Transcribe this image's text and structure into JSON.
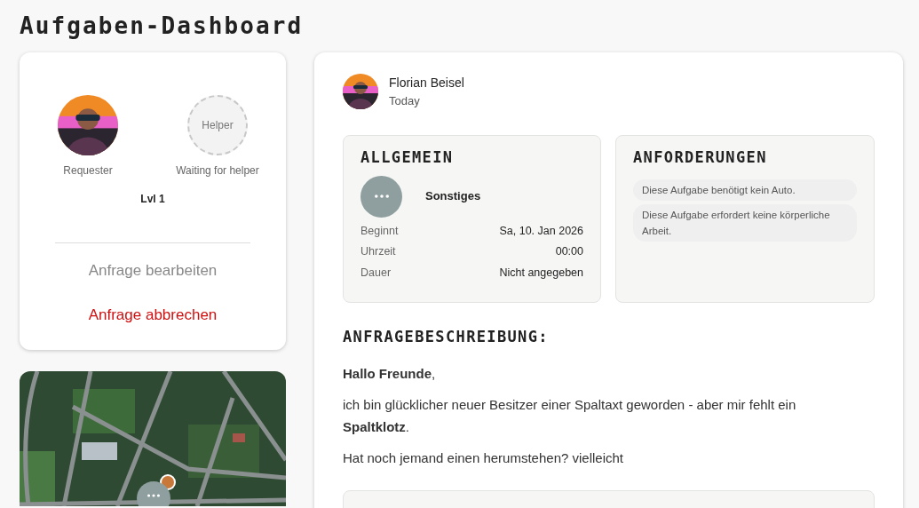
{
  "title": "Aufgaben-Dashboard",
  "participants": [
    {
      "kind": "avatar",
      "role": "Requester"
    },
    {
      "kind": "placeholder",
      "circle_label": "Helper",
      "role": "Waiting for helper"
    }
  ],
  "level": "Lvl 1",
  "actions": [
    {
      "label": "Anfrage bearbeiten",
      "kind": "neutral"
    },
    {
      "label": "Anfrage abbrechen",
      "kind": "danger"
    }
  ],
  "author": {
    "name": "Florian Beisel",
    "date": "Today"
  },
  "general": {
    "heading": "ALLGEMEIN",
    "category": "Sonstiges",
    "details": [
      {
        "label": "Beginnt",
        "value": "Sa, 10. Jan 2026"
      },
      {
        "label": "Uhrzeit",
        "value": "00:00"
      },
      {
        "label": "Dauer",
        "value": "Nicht angegeben"
      }
    ]
  },
  "requirements": {
    "heading": "ANFORDERUNGEN",
    "items": [
      "Diese Aufgabe benötigt kein Auto.",
      "Diese Aufgabe erfordert keine körperliche Arbeit."
    ]
  },
  "description": {
    "heading": "ANFRAGEBESCHREIBUNG:",
    "paragraphs": [
      "**Hallo Freunde**,",
      "ich bin glücklicher neuer Besitzer einer Spaltaxt geworden - aber mir fehlt ein **Spaltklotz**.",
      "Hat noch jemand einen herumstehen? vielleicht"
    ]
  }
}
